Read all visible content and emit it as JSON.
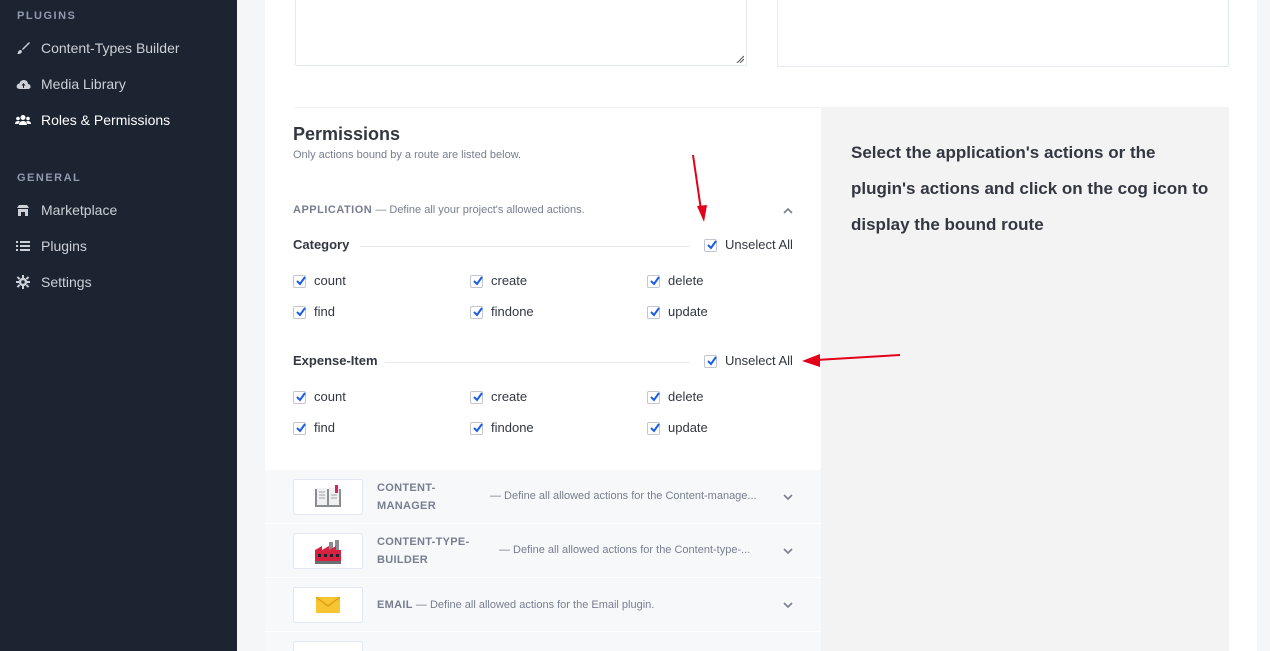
{
  "sidebar": {
    "plugins_title": "PLUGINS",
    "plugins_items": [
      {
        "label": "Content-Types Builder",
        "icon": "paint-brush-icon"
      },
      {
        "label": "Media Library",
        "icon": "cloud-upload-icon"
      },
      {
        "label": "Roles & Permissions",
        "icon": "users-icon",
        "active": true
      }
    ],
    "general_title": "GENERAL",
    "general_items": [
      {
        "label": "Marketplace",
        "icon": "shop-icon"
      },
      {
        "label": "Plugins",
        "icon": "list-icon"
      },
      {
        "label": "Settings",
        "icon": "gear-icon"
      }
    ]
  },
  "permissions": {
    "title": "Permissions",
    "subtitle": "Only actions bound by a route are listed below.",
    "application_label": "APPLICATION",
    "application_desc": "— Define all your project's allowed actions.",
    "groups": [
      {
        "name": "Category",
        "unselect_label": "Unselect All",
        "actions": [
          "count",
          "create",
          "delete",
          "find",
          "findone",
          "update"
        ]
      },
      {
        "name": "Expense-Item",
        "unselect_label": "Unselect All",
        "actions": [
          "count",
          "create",
          "delete",
          "find",
          "findone",
          "update"
        ]
      }
    ],
    "plugins": [
      {
        "name_line1": "CONTENT-",
        "name_line2": "MANAGER",
        "desc": "— Define all allowed actions for the Content-manage...",
        "icon": "book-icon"
      },
      {
        "name_line1": "CONTENT-TYPE-",
        "name_line2": "BUILDER",
        "desc": "— Define all allowed actions for the Content-type-...",
        "icon": "factory-icon"
      },
      {
        "name_line1": "EMAIL",
        "name_line2": "",
        "desc": "— Define all allowed actions for the Email plugin.",
        "icon": "envelope-icon"
      }
    ]
  },
  "help_text": "Select the application's actions or the plugin's actions and click on the cog icon to display the bound route",
  "colors": {
    "sidebar_bg": "#1c2331",
    "checkbox_accent": "#1c5de7",
    "arrow": "#e3001b"
  }
}
